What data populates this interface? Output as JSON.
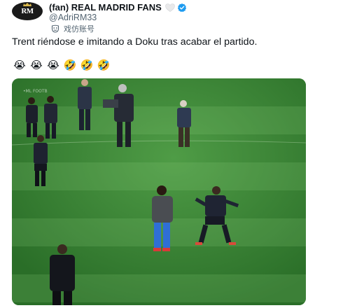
{
  "account": {
    "avatar_text": "RM",
    "display_name": "(fan) REAL MADRID FANS",
    "handle": "@AdriRM33",
    "label": "戏仿账号",
    "icons": [
      "heart-icon",
      "verified-badge-icon",
      "parody-mask-icon"
    ]
  },
  "tweet": {
    "text": "Trent riéndose e imitando a Doku tras acabar el partido.",
    "emojis": [
      "😭",
      "😭",
      "😭",
      "🤣",
      "🤣",
      "🤣"
    ]
  },
  "media": {
    "type": "video-still",
    "watermark": "•ML FOOTB"
  },
  "colors": {
    "text_primary": "#0f1419",
    "text_secondary": "#536471",
    "verified_blue": "#1d9bf0",
    "pitch_green": "#2f7a2c"
  }
}
